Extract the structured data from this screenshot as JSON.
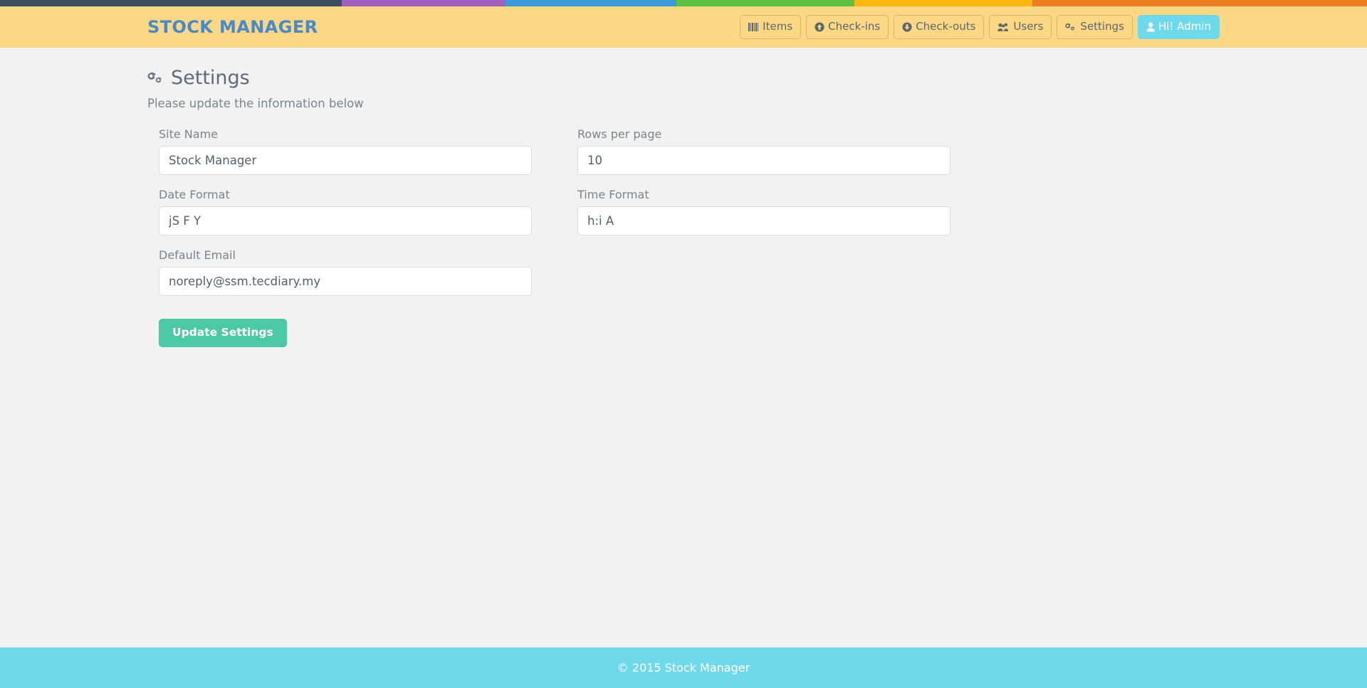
{
  "theme": {
    "navbar_bg": "#fcd884",
    "brand_color": "#4a89c8",
    "accent_cyan": "#6fd9ec",
    "accent_green": "#4bc8a4",
    "page_bg": "#f2f2f2",
    "text_color": "#5a6570"
  },
  "color_stripe": [
    {
      "name": "segment-dark",
      "color": "#3c4e5e",
      "width": 25.0
    },
    {
      "name": "segment-purple",
      "color": "#a161bf",
      "width": 12.0
    },
    {
      "name": "segment-blue",
      "color": "#3a9ad9",
      "width": 12.5
    },
    {
      "name": "segment-green",
      "color": "#5cc141",
      "width": 13.0
    },
    {
      "name": "segment-yellow",
      "color": "#fcb712",
      "width": 13.0
    },
    {
      "name": "segment-orange",
      "color": "#ec7d23",
      "width": 24.5
    }
  ],
  "navbar": {
    "brand": "STOCK MANAGER",
    "items": [
      {
        "label": "Items",
        "icon": "barcode-icon"
      },
      {
        "label": "Check-ins",
        "icon": "arrow-circle-up-icon"
      },
      {
        "label": "Check-outs",
        "icon": "arrow-circle-down-icon"
      },
      {
        "label": "Users",
        "icon": "users-icon"
      },
      {
        "label": "Settings",
        "icon": "gears-icon"
      },
      {
        "label": "Hi! Admin",
        "icon": "user-icon"
      }
    ]
  },
  "page": {
    "title": "Settings",
    "title_icon": "gears-icon",
    "subtitle": "Please update the information below"
  },
  "form": {
    "fields": {
      "site_name": {
        "label": "Site Name",
        "value": "Stock Manager",
        "placeholder": "Site Name"
      },
      "rows_per_page": {
        "label": "Rows per page",
        "value": "10",
        "placeholder": "Rows per page"
      },
      "date_format": {
        "label": "Date Format",
        "value": "jS F Y",
        "placeholder": "Date Format"
      },
      "time_format": {
        "label": "Time Format",
        "value": "h:i A",
        "placeholder": "Time Format"
      },
      "default_email": {
        "label": "Default Email",
        "value": "noreply@ssm.tecdiary.my",
        "placeholder": "Default Email"
      }
    },
    "submit_label": "Update Settings"
  },
  "footer": {
    "text": "© 2015 Stock Manager"
  }
}
